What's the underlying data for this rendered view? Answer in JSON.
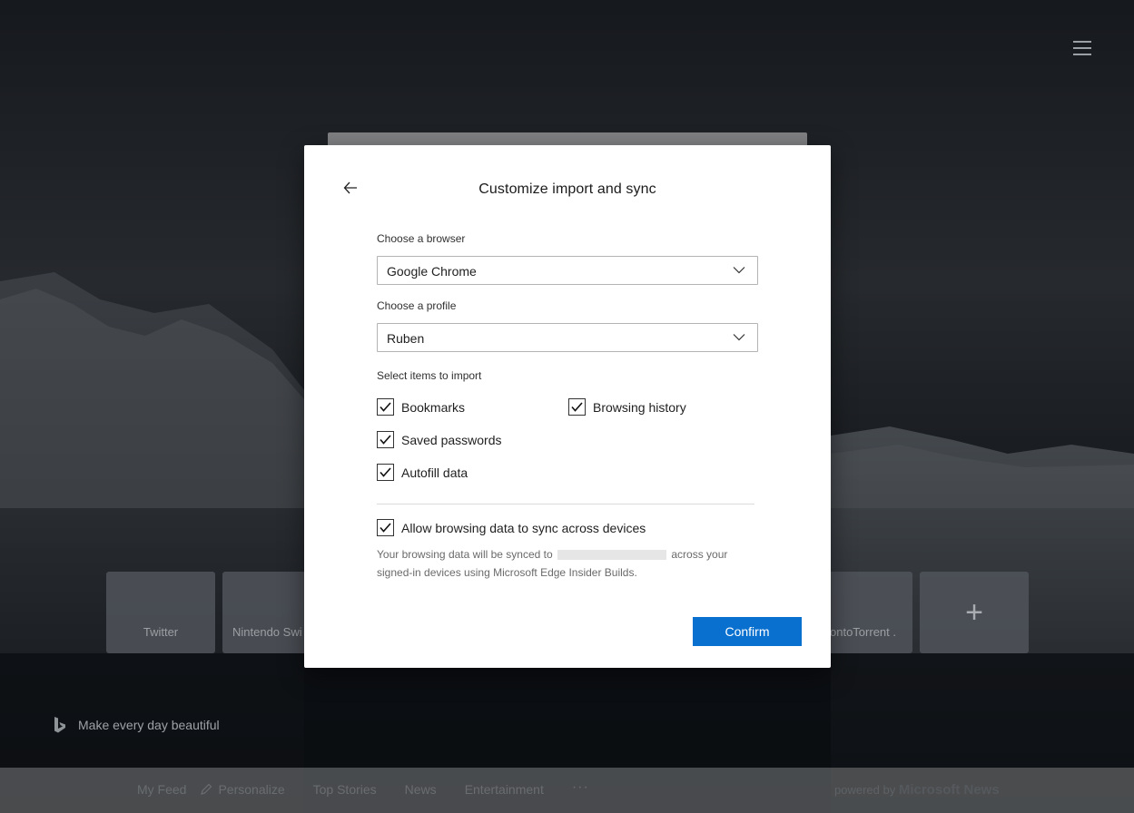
{
  "background": {
    "tiles": [
      {
        "label": "Twitter"
      },
      {
        "label": "Nintendo Swi"
      },
      {
        "label": "ontoTorrent ."
      },
      {
        "label": ""
      }
    ],
    "bing_tagline": "Make every day beautiful",
    "news_nav": [
      {
        "label": "My Feed"
      },
      {
        "label": "Personalize"
      },
      {
        "label": "Top Stories"
      },
      {
        "label": "News"
      },
      {
        "label": "Entertainment"
      }
    ],
    "more_label": "···",
    "powered_prefix": "powered by",
    "powered_brand": "Microsoft News"
  },
  "dialog": {
    "title": "Customize import and sync",
    "browser_label": "Choose a browser",
    "browser_value": "Google Chrome",
    "profile_label": "Choose a profile",
    "profile_value": "Ruben",
    "items_label": "Select items to import",
    "items": [
      {
        "label": "Bookmarks",
        "checked": true
      },
      {
        "label": "Browsing history",
        "checked": true
      },
      {
        "label": "Saved passwords",
        "checked": true
      },
      {
        "label": "Autofill data",
        "checked": true
      }
    ],
    "sync_label": "Allow browsing data to sync across devices",
    "sync_checked": true,
    "sync_desc_before": "Your browsing data will be synced to",
    "sync_desc_after": "across your signed-in devices using Microsoft Edge Insider Builds.",
    "confirm_label": "Confirm"
  },
  "colors": {
    "accent": "#0a70cf",
    "dialog_bg": "#ffffff"
  }
}
